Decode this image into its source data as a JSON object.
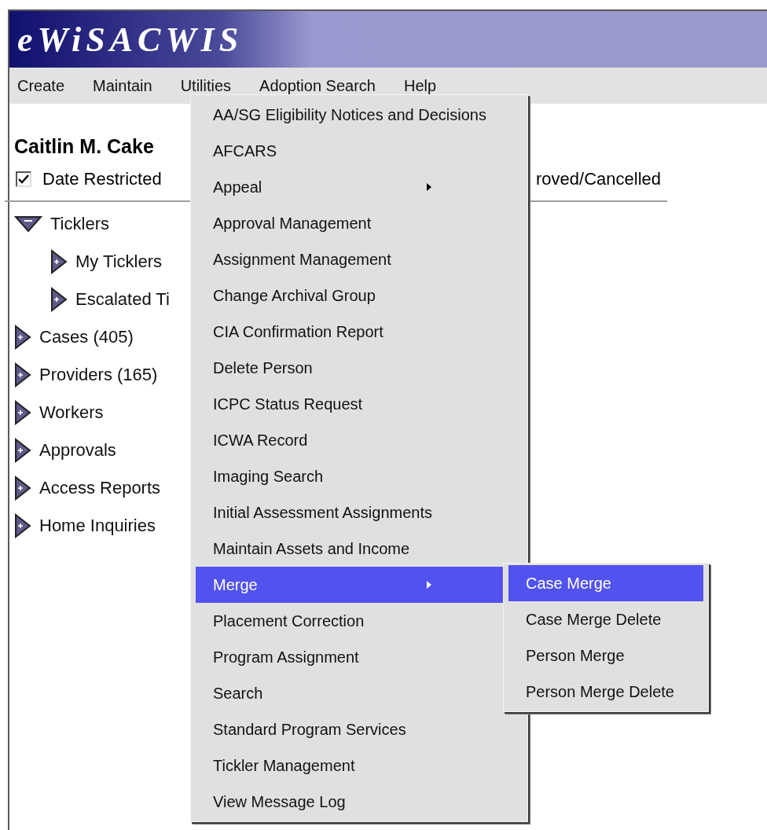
{
  "window": {
    "title": "eWiSACWIS"
  },
  "menu_bar": [
    "Create",
    "Maintain",
    "Utilities",
    "Adoption Search",
    "Help"
  ],
  "person_name": "Caitlin M. Cake",
  "filter": {
    "label": "Date Restricted",
    "checked": true
  },
  "filter_partial_label": "roved/Cancelled",
  "tree": [
    {
      "label": "Ticklers",
      "expanded": true,
      "children": [
        {
          "label": "My Ticklers",
          "expanded": false
        },
        {
          "label": "Escalated Ti",
          "expanded": false
        }
      ]
    },
    {
      "label": "Cases (405)",
      "expanded": false
    },
    {
      "label": "Providers (165)",
      "expanded": false
    },
    {
      "label": "Workers",
      "expanded": false
    },
    {
      "label": "Approvals",
      "expanded": false
    },
    {
      "label": "Access Reports",
      "expanded": false
    },
    {
      "label": "Home Inquiries",
      "expanded": false
    }
  ],
  "utilities_menu": [
    {
      "label": "AA/SG Eligibility Notices and Decisions",
      "has_submenu": false,
      "selected": false
    },
    {
      "label": "AFCARS",
      "has_submenu": false,
      "selected": false
    },
    {
      "label": "Appeal",
      "has_submenu": true,
      "selected": false
    },
    {
      "label": "Approval Management",
      "has_submenu": false,
      "selected": false
    },
    {
      "label": "Assignment Management",
      "has_submenu": false,
      "selected": false
    },
    {
      "label": "Change Archival Group",
      "has_submenu": false,
      "selected": false
    },
    {
      "label": "CIA Confirmation Report",
      "has_submenu": false,
      "selected": false
    },
    {
      "label": "Delete Person",
      "has_submenu": false,
      "selected": false
    },
    {
      "label": "ICPC Status Request",
      "has_submenu": false,
      "selected": false
    },
    {
      "label": "ICWA Record",
      "has_submenu": false,
      "selected": false
    },
    {
      "label": "Imaging Search",
      "has_submenu": false,
      "selected": false
    },
    {
      "label": "Initial Assessment Assignments",
      "has_submenu": false,
      "selected": false
    },
    {
      "label": "Maintain Assets and Income",
      "has_submenu": false,
      "selected": false
    },
    {
      "label": "Merge",
      "has_submenu": true,
      "selected": true
    },
    {
      "label": "Placement Correction",
      "has_submenu": false,
      "selected": false
    },
    {
      "label": "Program Assignment",
      "has_submenu": false,
      "selected": false
    },
    {
      "label": "Search",
      "has_submenu": false,
      "selected": false
    },
    {
      "label": "Standard Program Services",
      "has_submenu": false,
      "selected": false
    },
    {
      "label": "Tickler Management",
      "has_submenu": false,
      "selected": false
    },
    {
      "label": "View Message Log",
      "has_submenu": false,
      "selected": false
    }
  ],
  "merge_submenu": [
    {
      "label": "Case Merge",
      "selected": true
    },
    {
      "label": "Case Merge Delete",
      "selected": false
    },
    {
      "label": "Person Merge",
      "selected": false
    },
    {
      "label": "Person Merge Delete",
      "selected": false
    }
  ]
}
